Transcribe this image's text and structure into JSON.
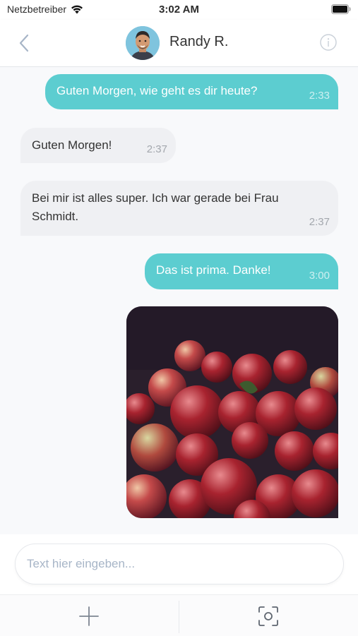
{
  "status_bar": {
    "carrier": "Netzbetreiber",
    "time": "3:02 AM",
    "icons": [
      "wifi-icon",
      "battery-icon"
    ]
  },
  "header": {
    "contact_name": "Randy R.",
    "icons": [
      "chevron-left-icon",
      "info-icon"
    ]
  },
  "messages": [
    {
      "direction": "outgoing",
      "text": "Guten Morgen, wie geht es dir heute?",
      "time": "2:33"
    },
    {
      "direction": "incoming",
      "text": "Guten Morgen!",
      "time": "2:37"
    },
    {
      "direction": "incoming",
      "text": "Bei mir ist alles super. Ich war gerade bei Frau Schmidt.",
      "time": "2:37"
    },
    {
      "direction": "outgoing",
      "text": "Das ist prima. Danke!",
      "time": "3:00"
    },
    {
      "direction": "outgoing",
      "type": "image",
      "image": "apples-photo"
    }
  ],
  "composer": {
    "value": "",
    "placeholder": "Text hier eingeben..."
  },
  "toolbar": {
    "icons": [
      "plus-icon",
      "camera-scan-icon"
    ]
  },
  "colors": {
    "outgoing_bubble": "#5ccdd0",
    "incoming_bubble": "#eff0f3",
    "accent": "#a7b5c7"
  }
}
